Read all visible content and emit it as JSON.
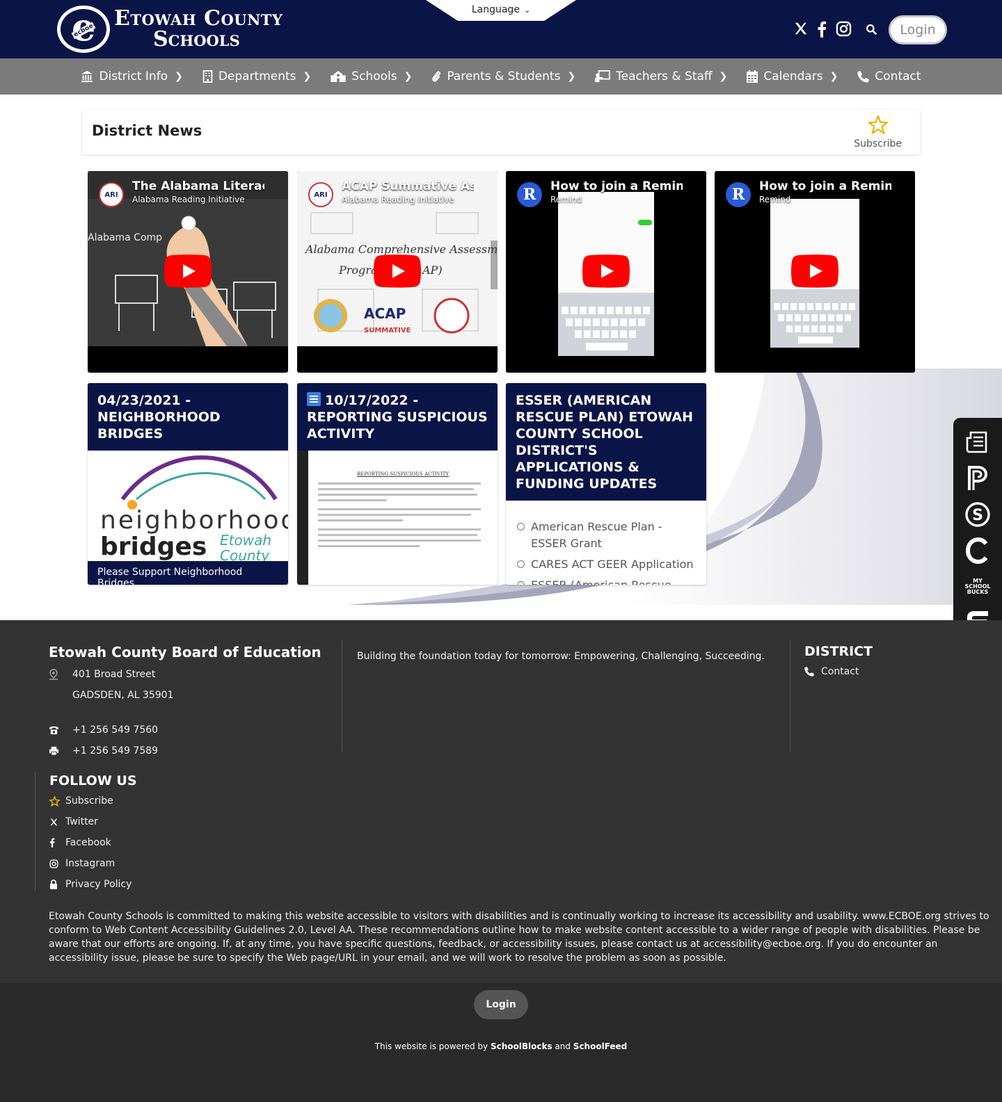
{
  "header": {
    "logo_line1": "Etowah County",
    "logo_line2": "Schools",
    "logo_badge": "ecboe",
    "language_label": "Language",
    "login_label": "Login"
  },
  "nav": {
    "items": [
      {
        "label": "District Info",
        "icon": "building-icon"
      },
      {
        "label": "Departments",
        "icon": "office-icon"
      },
      {
        "label": "Schools",
        "icon": "school-icon"
      },
      {
        "label": "Parents & Students",
        "icon": "paperclip-icon"
      },
      {
        "label": "Teachers & Staff",
        "icon": "chalkboard-icon"
      },
      {
        "label": "Calendars",
        "icon": "calendar-icon"
      },
      {
        "label": "Contact",
        "icon": "phone-icon"
      }
    ]
  },
  "news": {
    "title": "District News",
    "subscribe_label": "Subscribe"
  },
  "videos": [
    {
      "title": "The Alabama Literacy A",
      "channel": "Alabama Reading Initiative",
      "avatar": "ARI",
      "overlay": "Alabama Comp"
    },
    {
      "title": "ACAP Summative Asse",
      "channel": "Alabama Reading Initiative",
      "avatar": "ARI",
      "overlay": "Alabama Comprehensive Assessment",
      "overlay2": "Progra",
      "overlay3": "AP)",
      "logo_text": "ACAP",
      "logo_sub": "SUMMATIVE"
    },
    {
      "title": "How to join a Remind c",
      "channel": "Remind",
      "avatar": "R"
    },
    {
      "title": "How to join a Remind c",
      "channel": "Remind",
      "avatar": "R"
    }
  ],
  "tiles": {
    "bridges": {
      "heading": "04/23/2021 - NEIGHBORHOOD BRIDGES",
      "logo_word1": "neighborhood",
      "logo_word2": "bridges",
      "logo_sub1": "Etowah",
      "logo_sub2": "County",
      "caption": "Please Support Neighborhood Bridges"
    },
    "suspicious": {
      "heading": "10/17/2022 - REPORTING SUSPICIOUS ACTIVITY",
      "doc_title": "REPORTING SUSPICIOUS ACTIVITY"
    },
    "esser": {
      "heading": "ESSER (AMERICAN RESCUE PLAN) ETOWAH COUNTY SCHOOL DISTRICT'S APPLICATIONS & FUNDING UPDATES",
      "items": [
        "American Rescue Plan - ESSER Grant",
        "CARES ACT GEER Application",
        "ESSER (American Rescue Plan) Etowah County School"
      ]
    }
  },
  "sidebar_tools": {
    "mini_text": "MY SCHOOL BUCKS"
  },
  "footer": {
    "org_name": "Etowah County Board of Education",
    "address1": "401 Broad Street",
    "address2": "GADSDEN, AL 35901",
    "phone": "+1 256 549 7560",
    "fax": "+1 256 549 7589",
    "tagline": "Building the foundation today for tomorrow: Empowering, Challenging, Succeeding.",
    "district_heading": "DISTRICT",
    "district_contact": "Contact",
    "follow_heading": "FOLLOW US",
    "follow_links": {
      "subscribe": "Subscribe",
      "twitter": "Twitter",
      "facebook": "Facebook",
      "instagram": "Instagram",
      "privacy": "Privacy Policy"
    },
    "accessibility": "Etowah County Schools is committed to making this website accessible to visitors with disabilities and is continually working to increase its accessibility and usability. www.ECBOE.org strives to conform to Web Content Accessibility Guidelines 2.0, Level AA. These recommendations outline how to make website content accessible to a wider range of people with disabilities. Please be aware that our efforts are ongoing. If, at any time, you have specific questions, feedback, or accessibility issues, please contact us at accessibility@ecboe.org. If you do encounter an accessibility issue, please be sure to specify the Web page/URL in your email, and we will work to resolve the problem as soon as possible."
  },
  "bottom": {
    "login_label": "Login",
    "powered_prefix": "This website is powered by ",
    "powered_brand1": "SchoolBlocks",
    "powered_and": " and ",
    "powered_brand2": "SchoolFeed"
  },
  "colors": {
    "header_bg": "#0b1447",
    "nav_bg": "#7b7b7b",
    "footer_bg": "#333333",
    "bottom_bg": "#2a2a2a",
    "star": "#e6b800"
  }
}
